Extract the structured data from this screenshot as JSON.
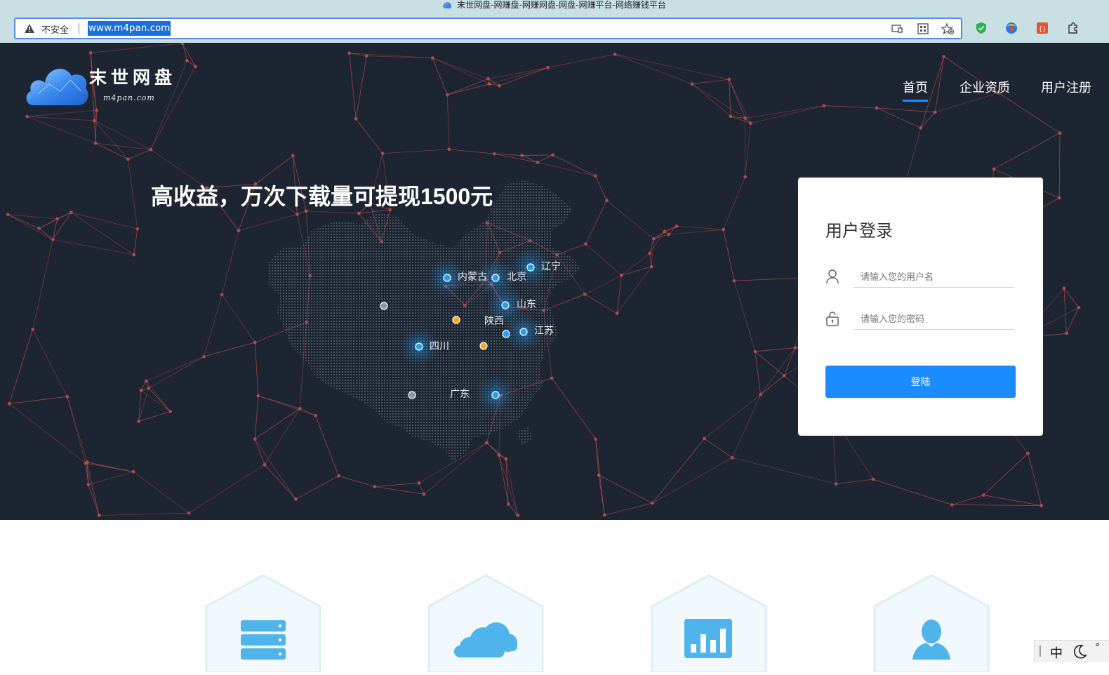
{
  "browser": {
    "window_title": "末世网盘-网赚盘-网赚网盘-网盘-网赚平台-网络赚钱平台",
    "security_label": "不安全",
    "url": "www.m4pan.com",
    "icons": [
      "tab-cast-icon",
      "qr-code-icon",
      "favorite-add-icon",
      "shield-extension-icon",
      "browser-extension-icon",
      "adblock-extension-icon",
      "puzzle-icon"
    ]
  },
  "site": {
    "logo_text": "末世网盘",
    "logo_domain": "m4pan.com",
    "nav": [
      {
        "label": "首页",
        "active": true
      },
      {
        "label": "企业资质",
        "active": false
      },
      {
        "label": "用户注册",
        "active": false
      }
    ],
    "headline": "高收益，万次下载量可提现1500元",
    "map_cities": [
      {
        "name": "内蒙古",
        "color": "#1ea0ff"
      },
      {
        "name": "北京",
        "color": "#1ea0ff"
      },
      {
        "name": "辽宁",
        "color": "#1ea0ff"
      },
      {
        "name": "山东",
        "color": "#1ea0ff"
      },
      {
        "name": "陕西",
        "color": "#f5a623"
      },
      {
        "name": "江苏",
        "color": "#1ea0ff"
      },
      {
        "name": "四川",
        "color": "#1ea0ff"
      },
      {
        "name": "广东",
        "color": "#1ea0ff"
      }
    ]
  },
  "login": {
    "title": "用户登录",
    "username_placeholder": "请输入您的用户名",
    "password_placeholder": "请输入您的密码",
    "submit_label": "登陆"
  },
  "features": [
    {
      "icon": "server-icon"
    },
    {
      "icon": "cloud-icon"
    },
    {
      "icon": "bar-chart-icon"
    },
    {
      "icon": "user-icon"
    }
  ],
  "taskbar": {
    "ime_label": "中",
    "icons": [
      "moon-icon"
    ],
    "degree": "°"
  },
  "colors": {
    "accent": "#1a8cff",
    "hero_bg": "#1d2532",
    "network": "#c0504d",
    "map_dot_blue": "#1ea0ff",
    "map_dot_orange": "#f5a623"
  }
}
